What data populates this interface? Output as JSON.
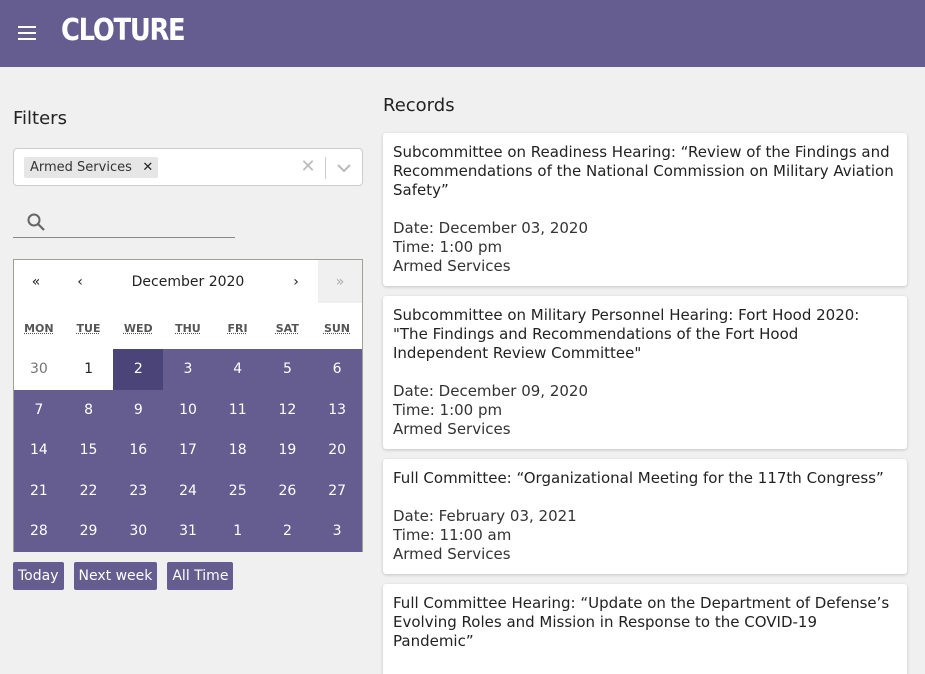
{
  "app": {
    "logo": "CLOTURE"
  },
  "filters": {
    "title": "Filters",
    "selected_chip": "Armed Services",
    "search_placeholder": ""
  },
  "calendar": {
    "prev_year": "«",
    "prev_month": "‹",
    "label": "December 2020",
    "next_month": "›",
    "next_year": "»",
    "weekdays": [
      "MON",
      "TUE",
      "WED",
      "THU",
      "FRI",
      "SAT",
      "SUN"
    ],
    "days": [
      "30",
      "1",
      "2",
      "3",
      "4",
      "5",
      "6",
      "7",
      "8",
      "9",
      "10",
      "11",
      "12",
      "13",
      "14",
      "15",
      "16",
      "17",
      "18",
      "19",
      "20",
      "21",
      "22",
      "23",
      "24",
      "25",
      "26",
      "27",
      "28",
      "29",
      "30",
      "31",
      "1",
      "2",
      "3"
    ]
  },
  "quick_buttons": {
    "today": "Today",
    "next_week": "Next week",
    "all_time": "All Time"
  },
  "records": {
    "title": "Records",
    "items": [
      {
        "title": "Subcommittee on Readiness Hearing: “Review of the Findings and Recommendations of the National Commission on Military Aviation Safety”",
        "date": "Date: December 03, 2020",
        "time": "Time: 1:00 pm",
        "committee": "Armed Services"
      },
      {
        "title": "Subcommittee on Military Personnel Hearing: Fort Hood 2020: \"The Findings and Recommendations of the Fort Hood Independent Review Committee\"",
        "date": "Date: December 09, 2020",
        "time": "Time: 1:00 pm",
        "committee": "Armed Services"
      },
      {
        "title": "Full Committee: “Organizational Meeting for the 117th Congress”",
        "date": "Date: February 03, 2021",
        "time": "Time: 11:00 am",
        "committee": "Armed Services"
      },
      {
        "title": "Full Committee Hearing: “Update on the Department of Defense’s Evolving Roles and Mission in Response to the COVID-19 Pandemic”",
        "date": "",
        "time": "",
        "committee": ""
      }
    ]
  },
  "colors": {
    "brand": "#655c90",
    "range_start": "#4a4478",
    "background": "#f0f0f0"
  }
}
